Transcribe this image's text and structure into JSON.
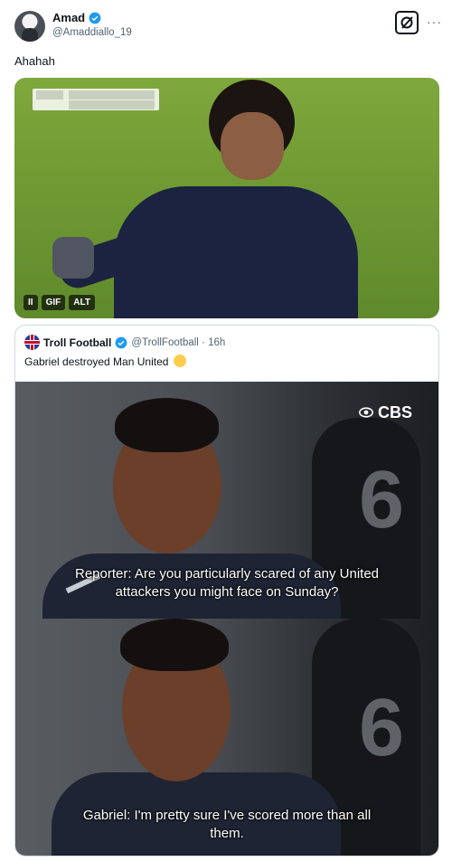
{
  "post": {
    "author_name": "Amad",
    "author_handle": "@Amaddiallo_19",
    "more_label": "···",
    "text": "Ahahah",
    "media_badges": {
      "pause": "II",
      "gif": "GIF",
      "alt": "ALT"
    }
  },
  "quote": {
    "author_name": "Troll Football",
    "author_handle": "@TrollFootball · 16h",
    "text": "Gabriel destroyed Man United",
    "watermark": "CBS",
    "jersey_number": "6",
    "subtitle_1_line1": "Reporter: Are you particularly scared of any United",
    "subtitle_1_line2": "attackers you might face on Sunday?",
    "subtitle_2_line1": "Gabriel: I'm pretty sure I've scored more than all",
    "subtitle_2_line2": "them."
  },
  "colors": {
    "verified": "#1d9bf0",
    "pitch": "#6f9a33",
    "kit": "#1c2340"
  }
}
